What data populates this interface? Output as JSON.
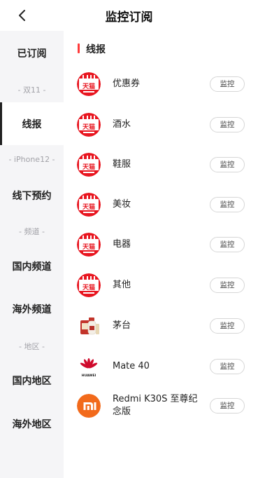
{
  "header": {
    "title": "监控订阅"
  },
  "sidebar": {
    "items": [
      {
        "type": "item",
        "label": "已订阅"
      },
      {
        "type": "sep",
        "label": "- 双11 -"
      },
      {
        "type": "item",
        "label": "线报",
        "active": true
      },
      {
        "type": "sep",
        "label": "- iPhone12 -"
      },
      {
        "type": "item",
        "label": "线下预约"
      },
      {
        "type": "sep",
        "label": "- 频道 -"
      },
      {
        "type": "item",
        "label": "国内频道"
      },
      {
        "type": "item",
        "label": "海外频道"
      },
      {
        "type": "sep",
        "label": "- 地区 -"
      },
      {
        "type": "item",
        "label": "国内地区"
      },
      {
        "type": "item",
        "label": "海外地区"
      }
    ]
  },
  "main": {
    "section_title": "线报",
    "monitor_label": "监控",
    "rows": [
      {
        "name": "优惠券",
        "logo": "tmall-double11-icon",
        "logo_text": "天猫"
      },
      {
        "name": "酒水",
        "logo": "tmall-double11-icon",
        "logo_text": "天猫"
      },
      {
        "name": "鞋服",
        "logo": "tmall-double11-icon",
        "logo_text": "天猫"
      },
      {
        "name": "美妆",
        "logo": "tmall-double11-icon",
        "logo_text": "天猫"
      },
      {
        "name": "电器",
        "logo": "tmall-double11-icon",
        "logo_text": "天猫"
      },
      {
        "name": "其他",
        "logo": "tmall-double11-icon",
        "logo_text": "天猫"
      },
      {
        "name": "茅台",
        "logo": "moutai-bottle-icon"
      },
      {
        "name": "Mate 40",
        "logo": "huawei-logo-icon",
        "logo_text": "HUAWEI"
      },
      {
        "name": "Redmi K30S 至尊纪念版",
        "logo": "xiaomi-logo-icon"
      }
    ]
  },
  "colors": {
    "accent": "#ff3a3a",
    "sidebar_bg": "#f5f5f7",
    "tmall_red": "#e8151f",
    "xiaomi_orange": "#f26a1b",
    "huawei_red": "#cf0a2c"
  }
}
